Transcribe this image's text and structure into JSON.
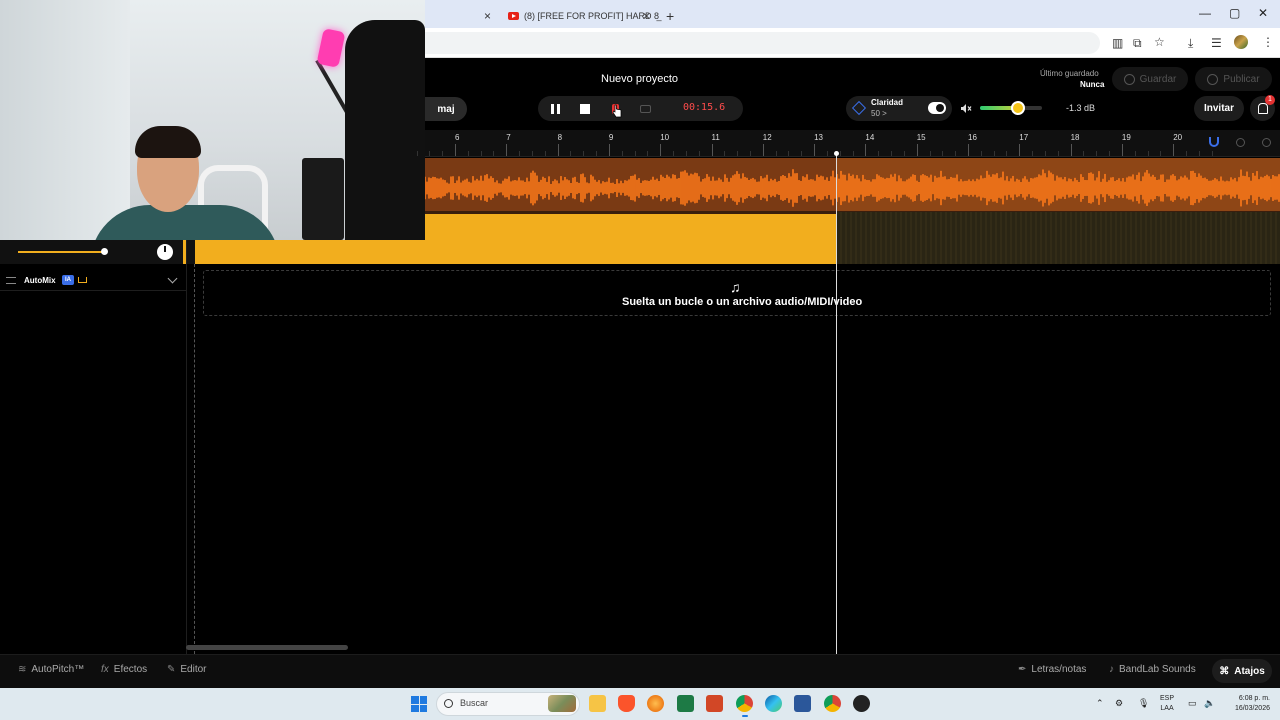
{
  "browser": {
    "tab_title": "(8) [FREE FOR PROFIT] HARD 8̲",
    "new_tab": "+",
    "close": "×",
    "window_controls": [
      "—",
      "▢",
      "✕"
    ]
  },
  "header": {
    "project_title": "Nuevo proyecto",
    "key_label": "maj",
    "time": "00:15.6",
    "clarity_label": "Claridad",
    "clarity_value": "50 >",
    "volume_db": "-1.3 dB",
    "volume_level": 0.62,
    "last_saved_label": "Último guardado",
    "last_saved_value": "Nunca",
    "save_label": "Guardar",
    "publish_label": "Publicar",
    "invite_label": "Invitar",
    "notification_count": "1"
  },
  "ruler": {
    "bars": [
      "6",
      "7",
      "8",
      "9",
      "10",
      "11",
      "12",
      "13",
      "14",
      "15",
      "16",
      "17",
      "18",
      "19",
      "20"
    ]
  },
  "track": {
    "automix_label": "AutoMix",
    "ia_badge": "IA"
  },
  "drop_zone": {
    "text": "Suelta un bucle o un archivo audio/MIDI/video"
  },
  "bottom_bar": {
    "autopitch": "AutoPitch™",
    "effects": "Efectos",
    "editor": "Editor",
    "lyrics": "Letras/notas",
    "sounds": "BandLab Sounds",
    "shortcuts": "Atajos"
  },
  "taskbar": {
    "search_placeholder": "Buscar",
    "lang_1": "ESP",
    "lang_2": "LAA",
    "time": "6:08 p. m.",
    "date": "16/03/2026"
  },
  "colors": {
    "accent_orange": "#ff7a1a",
    "region_yellow": "#f2ae1e",
    "record_red": "#e53232",
    "brand_blue": "#3a6ee8"
  }
}
